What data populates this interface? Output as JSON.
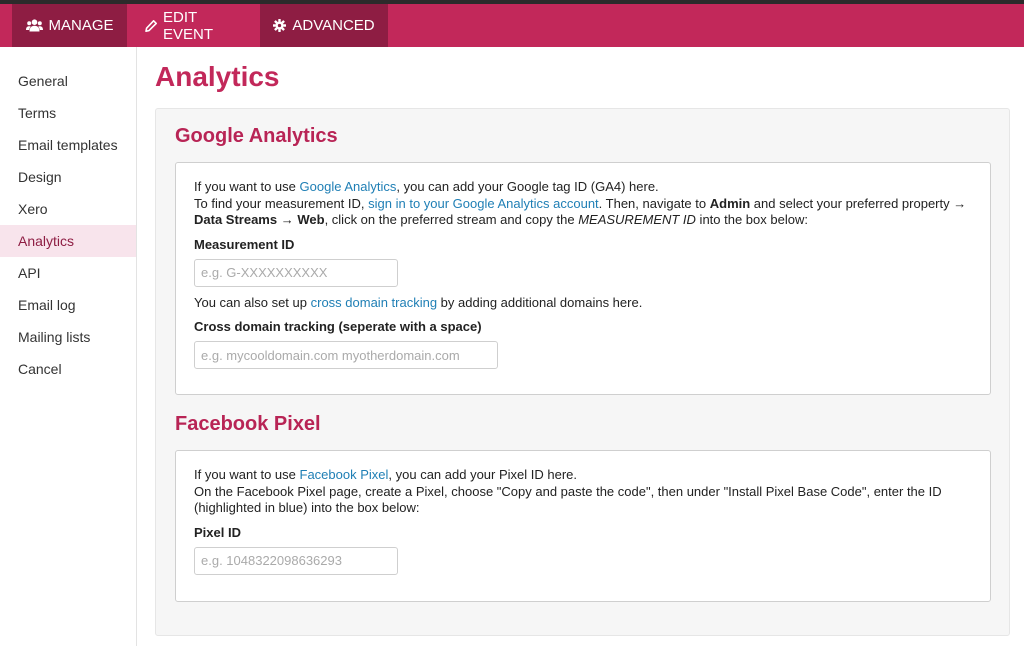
{
  "topnav": {
    "manage": "MANAGE",
    "edit_event": "EDIT EVENT",
    "advanced": "ADVANCED"
  },
  "sidebar": {
    "items": [
      {
        "label": "General"
      },
      {
        "label": "Terms"
      },
      {
        "label": "Email templates"
      },
      {
        "label": "Design"
      },
      {
        "label": "Xero"
      },
      {
        "label": "Analytics",
        "active": true
      },
      {
        "label": "API"
      },
      {
        "label": "Email log"
      },
      {
        "label": "Mailing lists"
      },
      {
        "label": "Cancel"
      }
    ]
  },
  "page": {
    "title": "Analytics"
  },
  "google": {
    "title": "Google Analytics",
    "intro_1": "If you want to use ",
    "intro_link": "Google Analytics",
    "intro_2": ", you can add your Google tag ID (GA4) here.",
    "find_1": "To find your measurement ID, ",
    "find_link": "sign in to your Google Analytics account",
    "find_2": ". Then, navigate to ",
    "admin": "Admin",
    "find_3": " and select your preferred property → ",
    "data_streams": "Data Streams",
    "arrow": " → ",
    "web": "Web",
    "find_4": ", click on the preferred stream and copy the ",
    "measurement_id_em": "MEASUREMENT ID",
    "find_5": " into the box below:",
    "measurement_label": "Measurement ID",
    "measurement_placeholder": "e.g. G-XXXXXXXXXX",
    "cross_1": "You can also set up ",
    "cross_link": "cross domain tracking",
    "cross_2": " by adding additional domains here.",
    "cross_label": "Cross domain tracking (seperate with a space)",
    "cross_placeholder": "e.g. mycooldomain.com myotherdomain.com"
  },
  "facebook": {
    "title": "Facebook Pixel",
    "intro_1": "If you want to use ",
    "intro_link": "Facebook Pixel",
    "intro_2": ", you can add your Pixel ID here.",
    "instructions": "On the Facebook Pixel page, create a Pixel, choose \"Copy and paste the code\", then under \"Install Pixel Base Code\", enter the ID (highlighted in blue) into the box below:",
    "pixel_label": "Pixel ID",
    "pixel_placeholder": "e.g. 1048322098636293"
  },
  "colors": {
    "brand": "#c2285a",
    "brand_dark": "#8e1d43",
    "link": "#1f7fb5"
  },
  "icons": {
    "manage": "users-icon",
    "edit_event": "pencil-icon",
    "advanced": "gear-icon"
  }
}
